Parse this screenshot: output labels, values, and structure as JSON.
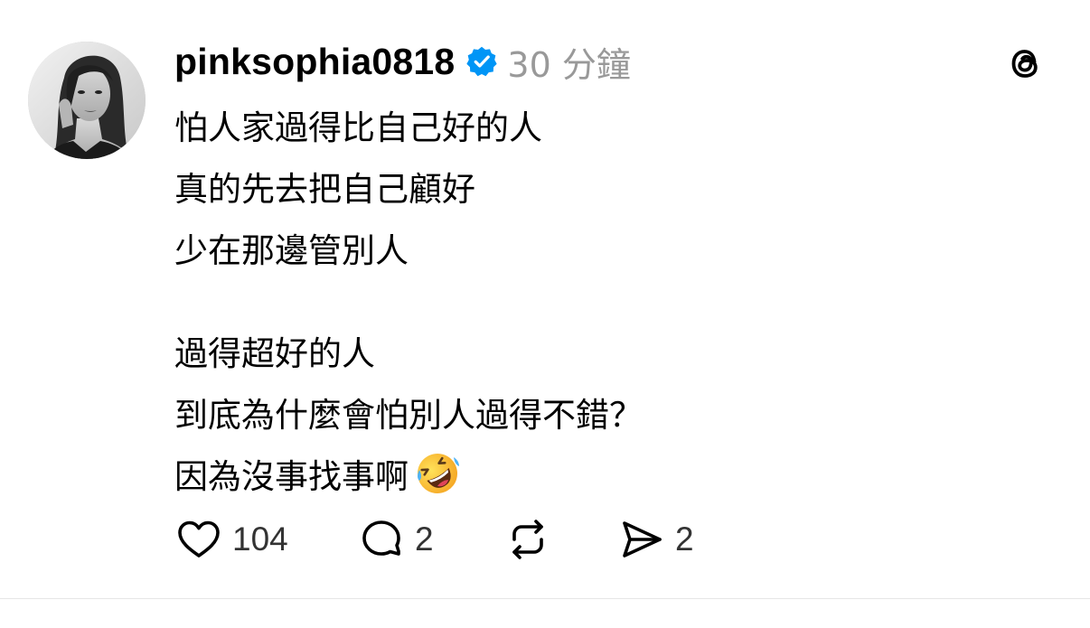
{
  "post": {
    "username": "pinksophia0818",
    "verified": true,
    "timestamp": "30 分鐘",
    "paragraphs": [
      [
        "怕人家過得比自己好的人",
        "真的先去把自己顧好",
        "少在那邊管別人"
      ],
      [
        "過得超好的人",
        "到底為什麼會怕別人過得不錯？",
        "因為沒事找事啊"
      ]
    ],
    "trailing_emoji": "rolling-on-the-floor-laughing-emoji"
  },
  "actions": {
    "likes": "104",
    "comments": "2",
    "shares": "2"
  },
  "icons": {
    "verified": "verified-badge-icon",
    "app": "threads-logo-icon",
    "like": "heart-icon",
    "comment": "comment-bubble-icon",
    "repost": "repost-icon",
    "share": "share-send-icon"
  },
  "colors": {
    "verified_blue": "#0095F6",
    "timestamp_gray": "#999999",
    "text": "#000000"
  }
}
